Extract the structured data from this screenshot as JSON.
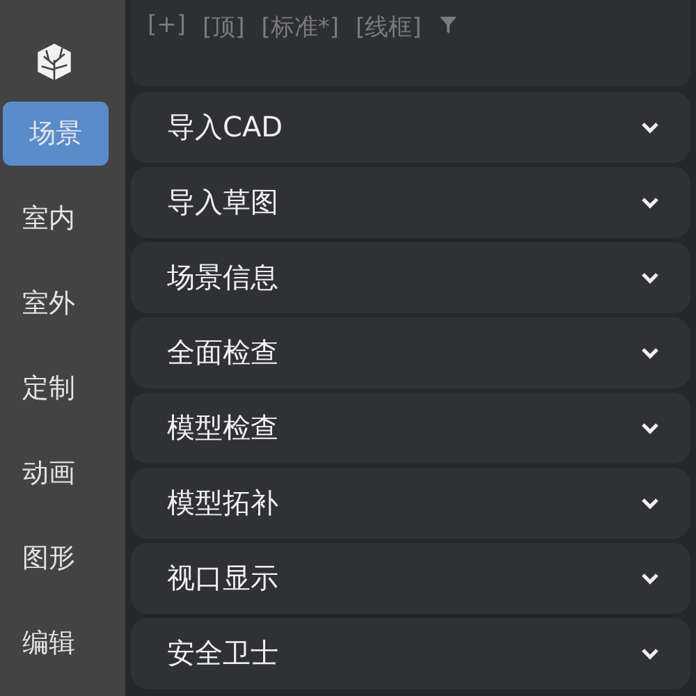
{
  "viewport_labels": [
    "[+]",
    "[顶]",
    "[标准*]",
    "[线框]"
  ],
  "sidebar": {
    "items": [
      {
        "label": "场景",
        "selected": true
      },
      {
        "label": "室内",
        "selected": false
      },
      {
        "label": "室外",
        "selected": false
      },
      {
        "label": "定制",
        "selected": false
      },
      {
        "label": "动画",
        "selected": false
      },
      {
        "label": "图形",
        "selected": false
      },
      {
        "label": "编辑",
        "selected": false
      }
    ]
  },
  "panels": [
    {
      "label": "导入CAD",
      "expanded": false
    },
    {
      "label": "导入草图",
      "expanded": false
    },
    {
      "label": "场景信息",
      "expanded": false
    },
    {
      "label": "全面检查",
      "expanded": false
    },
    {
      "label": "模型检查",
      "expanded": false
    },
    {
      "label": "模型拓补",
      "expanded": false
    },
    {
      "label": "视口显示",
      "expanded": false
    },
    {
      "label": "安全卫士",
      "expanded": false
    }
  ]
}
